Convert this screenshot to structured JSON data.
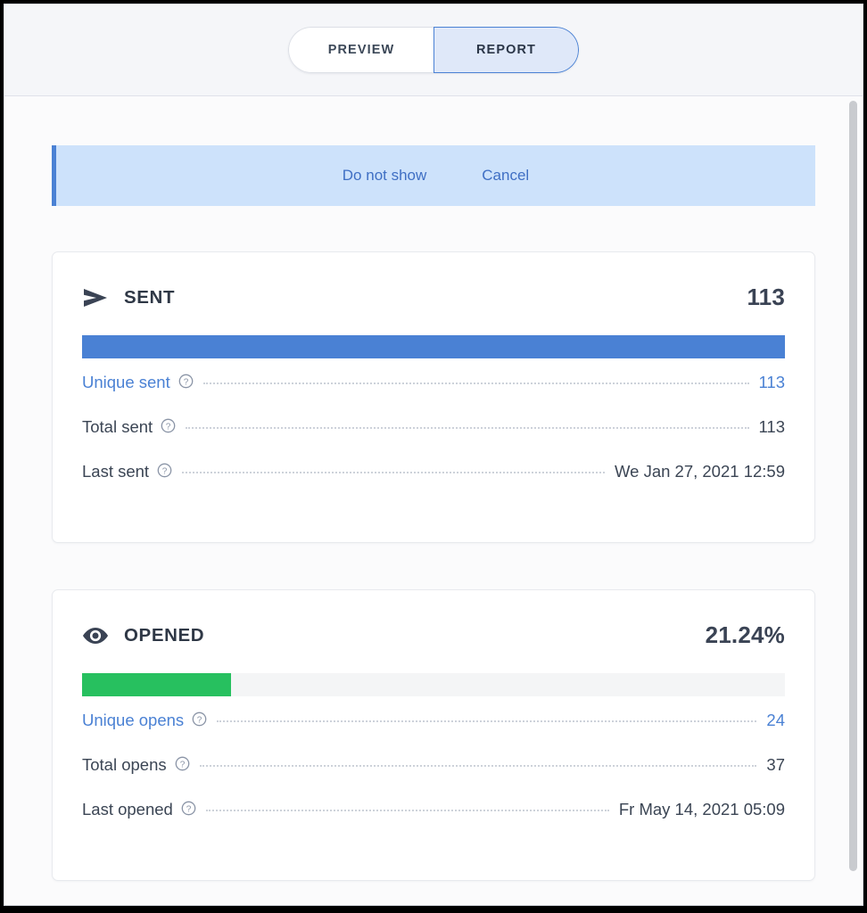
{
  "header": {
    "tabs": [
      {
        "label": "PREVIEW",
        "active": false,
        "name": "tab-preview"
      },
      {
        "label": "REPORT",
        "active": true,
        "name": "tab-report"
      }
    ]
  },
  "banner": {
    "do_not_show_label": "Do not show",
    "cancel_label": "Cancel",
    "accent_color": "#4a81d4",
    "background_color": "#cde2fb"
  },
  "cards": {
    "sent": {
      "icon": "send-icon",
      "title": "SENT",
      "value": "113",
      "bar_color": "#4a81d4",
      "bar_percent": 100,
      "rows": [
        {
          "label": "Unique sent",
          "value": "113",
          "link": true,
          "help": "help-icon"
        },
        {
          "label": "Total sent",
          "value": "113",
          "link": false,
          "help": "help-icon"
        },
        {
          "label": "Last sent",
          "value": "We Jan 27, 2021 12:59",
          "link": false,
          "help": "help-icon"
        }
      ]
    },
    "opened": {
      "icon": "eye-icon",
      "title": "OPENED",
      "value": "21.24%",
      "bar_color": "#27c05f",
      "bar_percent": 21.24,
      "rows": [
        {
          "label": "Unique opens",
          "value": "24",
          "link": true,
          "help": "help-icon"
        },
        {
          "label": "Total opens",
          "value": "37",
          "link": false,
          "help": "help-icon"
        },
        {
          "label": "Last opened",
          "value": "Fr May 14, 2021 05:09",
          "link": false,
          "help": "help-icon"
        }
      ]
    }
  },
  "scrollbar": {
    "name": "vertical-scrollbar"
  }
}
